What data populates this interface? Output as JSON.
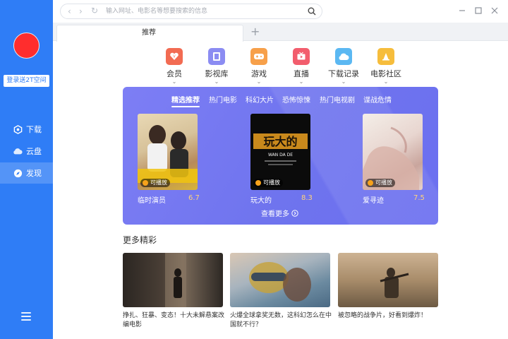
{
  "sidebar": {
    "login_label": "登录送2T空间",
    "items": [
      {
        "label": "下载",
        "icon": "hexagon-icon"
      },
      {
        "label": "云盘",
        "icon": "cloud-icon"
      },
      {
        "label": "发现",
        "icon": "compass-icon"
      }
    ],
    "active_index": 2
  },
  "address": {
    "placeholder": "输入网址、电影名等想要搜索的信息"
  },
  "tab": {
    "label": "推荐"
  },
  "categories": [
    {
      "label": "会员",
      "icon": "vip-heart-icon",
      "color": "#f26b52"
    },
    {
      "label": "影视库",
      "icon": "film-icon",
      "color": "#8b8cf2"
    },
    {
      "label": "游戏",
      "icon": "gamepad-icon",
      "color": "#f7a04a"
    },
    {
      "label": "直播",
      "icon": "tv-icon",
      "color": "#f25d6d"
    },
    {
      "label": "下载记录",
      "icon": "cloud-download-icon",
      "color": "#5bb8f2"
    },
    {
      "label": "电影社区",
      "icon": "community-icon",
      "color": "#f6bd3c"
    }
  ],
  "panel": {
    "tabs": [
      "精选推荐",
      "热门电影",
      "科幻大片",
      "恐怖惊悚",
      "热门电视剧",
      "谍战危情"
    ],
    "active_tab": 0,
    "play_label": "可播放",
    "see_more": "查看更多",
    "movies": [
      {
        "title": "临时演员",
        "score": "6.7"
      },
      {
        "title": "玩大的",
        "score": "8.3"
      },
      {
        "title": "爱寻迹",
        "score": "7.5"
      }
    ],
    "poster_text": {
      "title_cn": "玩大的",
      "title_en": "WAN DA DE"
    }
  },
  "more": {
    "title": "更多精彩",
    "items": [
      {
        "caption": "挣扎、狂暴、变态！十大未解悬案改编电影"
      },
      {
        "caption": "火爆全球拿奖无数，这科幻怎么在中国就不行？"
      },
      {
        "caption": "被忽略的战争片，好看到爆炸！"
      }
    ]
  },
  "colors": {
    "sidebar": "#2f7df6",
    "panel": "#7479f0",
    "avatar": "#ff2d2d"
  }
}
